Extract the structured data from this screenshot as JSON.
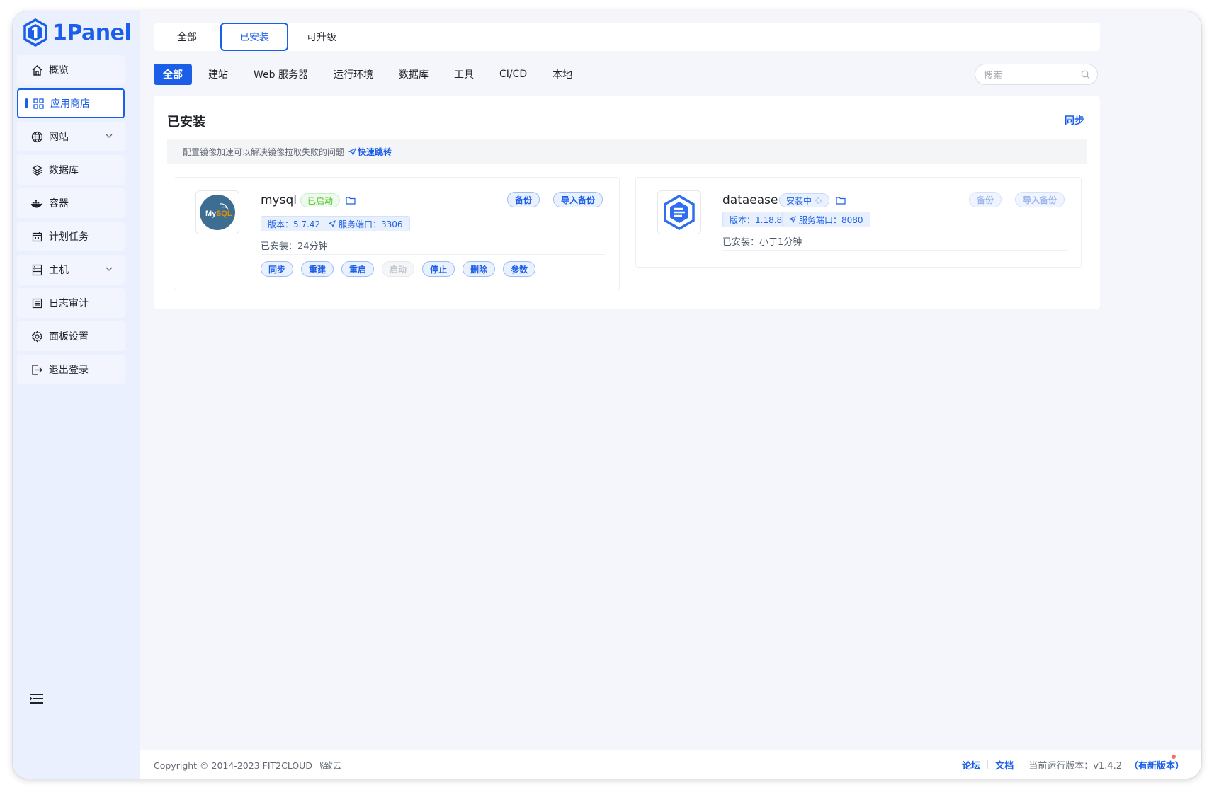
{
  "brand": {
    "name": "1Panel",
    "color": "#1b5ee8"
  },
  "sidebar": {
    "items": [
      {
        "label": "概览",
        "icon": "home-icon"
      },
      {
        "label": "应用商店",
        "icon": "grid-icon",
        "active": true
      },
      {
        "label": "网站",
        "icon": "globe-icon",
        "expandable": true
      },
      {
        "label": "数据库",
        "icon": "layers-icon"
      },
      {
        "label": "容器",
        "icon": "docker-icon"
      },
      {
        "label": "计划任务",
        "icon": "calendar-icon"
      },
      {
        "label": "主机",
        "icon": "server-icon",
        "expandable": true
      },
      {
        "label": "日志审计",
        "icon": "log-icon"
      },
      {
        "label": "面板设置",
        "icon": "gear-icon"
      },
      {
        "label": "退出登录",
        "icon": "logout-icon"
      }
    ],
    "collapse_icon": "menu-collapse-icon"
  },
  "top_tabs": [
    {
      "label": "全部"
    },
    {
      "label": "已安装",
      "active": true
    },
    {
      "label": "可升级"
    }
  ],
  "categories": [
    {
      "label": "全部",
      "active": true
    },
    {
      "label": "建站"
    },
    {
      "label": "Web 服务器"
    },
    {
      "label": "运行环境"
    },
    {
      "label": "数据库"
    },
    {
      "label": "工具"
    },
    {
      "label": "CI/CD"
    },
    {
      "label": "本地"
    }
  ],
  "search": {
    "placeholder": "搜索"
  },
  "panel": {
    "title": "已安装",
    "sync_label": "同步",
    "notice": "配置镜像加速可以解决镜像拉取失败的问题",
    "notice_link": "快速跳转"
  },
  "apps": [
    {
      "name": "mysql",
      "status": "已启动",
      "status_color": "#52c41a",
      "backup_label": "备份",
      "import_label": "导入备份",
      "version_tag": "版本：5.7.42",
      "port_tag": "服务端口：3306",
      "installed_label": "已安装：",
      "installed_time": "24分钟",
      "logo_text": "MySQL",
      "actions": [
        {
          "label": "同步"
        },
        {
          "label": "重建"
        },
        {
          "label": "重启"
        },
        {
          "label": "启动",
          "disabled": true
        },
        {
          "label": "停止"
        },
        {
          "label": "删除"
        },
        {
          "label": "参数"
        }
      ]
    },
    {
      "name": "dataease",
      "status": "安装中",
      "status_color": "#1b5ee8",
      "backup_label": "备份",
      "import_label": "导入备份",
      "version_tag": "版本：1.18.8",
      "port_tag": "服务端口：8080",
      "installed_label": "已安装：",
      "installed_time": "小于1分钟"
    }
  ],
  "footer": {
    "copyright": "Copyright © 2014-2023 FIT2CLOUD 飞致云",
    "forum": "论坛",
    "docs": "文档",
    "version_label": "当前运行版本：v1.4.2",
    "new_version": "（有新版本）"
  }
}
